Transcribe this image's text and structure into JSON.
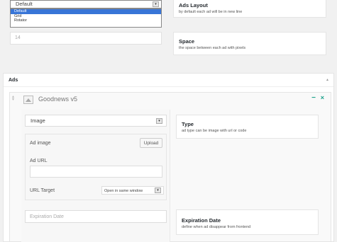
{
  "layout_section": {
    "select_value": "Default",
    "options": [
      "Default",
      "Grid",
      "Rotator"
    ],
    "selected_option": "Default",
    "title": "Ads Layout",
    "description": "by default each ad will be in new line"
  },
  "space_section": {
    "input_value": "14",
    "title": "Space",
    "description": "the space between each ad with pixels"
  },
  "ads_box": {
    "title": "Ads",
    "toggle": "▲",
    "ad": {
      "title": "Goodnews v5",
      "minimize": "−",
      "close": "×",
      "type_select": "Image",
      "type_title": "Type",
      "type_description": "ad type can be image with url or code",
      "ad_image_label": "Ad image",
      "upload_label": "Upload",
      "ad_url_label": "Ad URL",
      "ad_url_value": "",
      "url_target_label": "URL Target",
      "url_target_value": "Open in same window",
      "expiration_placeholder": "Expiration Date",
      "expiration_title": "Expiration Date",
      "expiration_description": "define when ad disappear from frontend"
    }
  },
  "icons": {
    "select_arrow": "▾",
    "drag": "↕"
  }
}
